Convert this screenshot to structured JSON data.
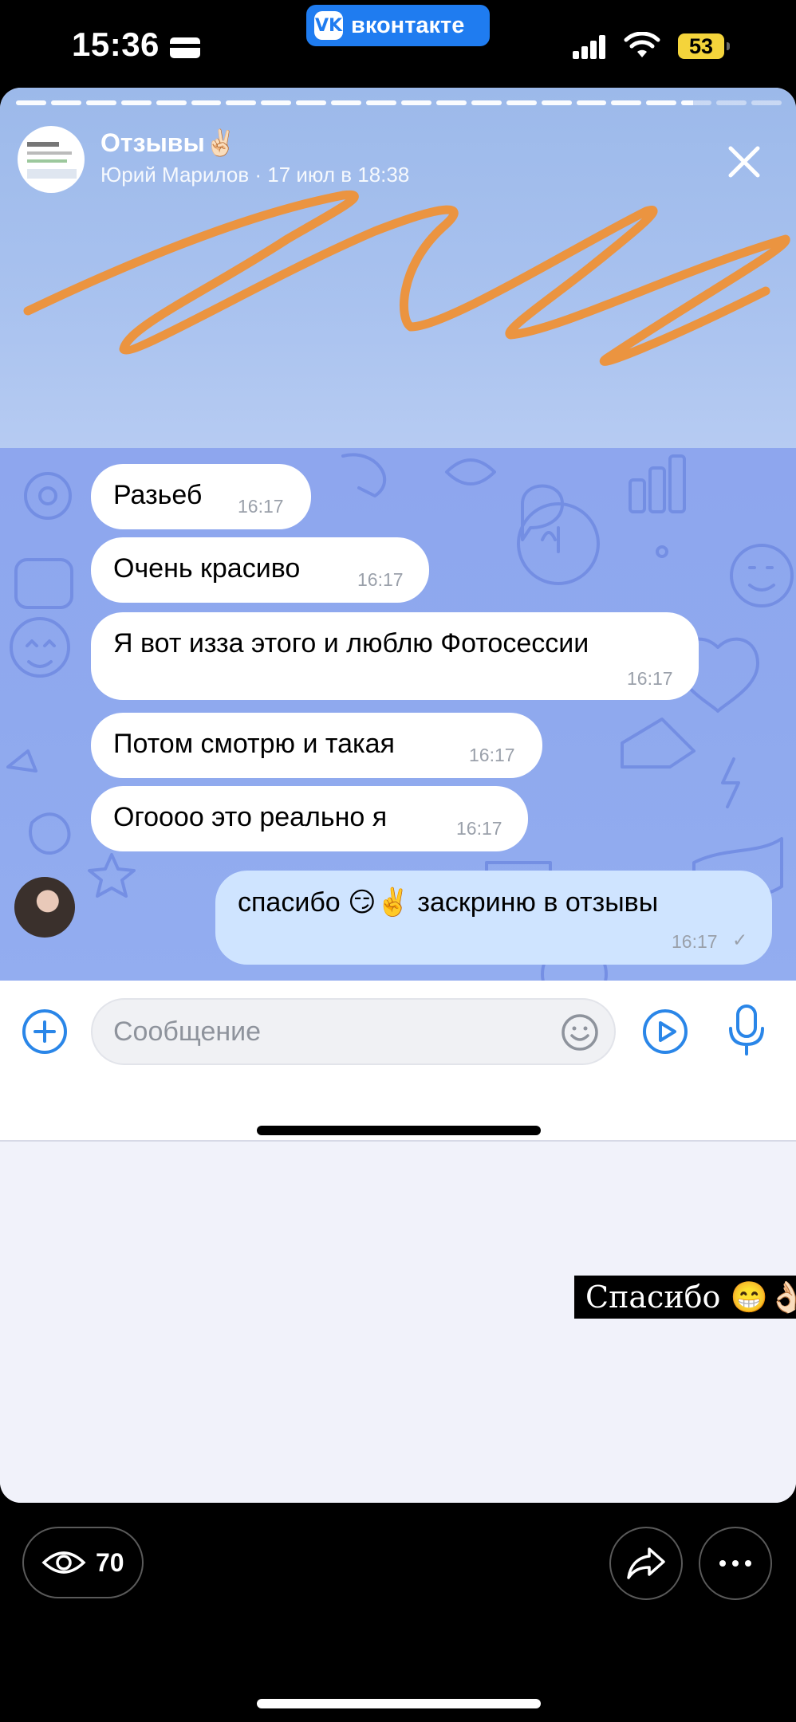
{
  "status_bar": {
    "time": "15:36",
    "app_pill": "вконтакте",
    "app_logo": "VK",
    "battery": "53"
  },
  "story": {
    "title": "Отзывы✌🏻",
    "subtitle": "Юрий Марилов · 17 июл в 18:38",
    "progress_segments_total": 22,
    "progress_segments_done": 19
  },
  "chat": {
    "messages": [
      {
        "text": "Разьеб",
        "time": "16:17",
        "incoming": true
      },
      {
        "text": "Очень красиво",
        "time": "16:17",
        "incoming": true
      },
      {
        "text": "Я вот изза этого и люблю Фотосессии",
        "time": "16:17",
        "incoming": true
      },
      {
        "text": "Потом смотрю и такая",
        "time": "16:17",
        "incoming": true
      },
      {
        "text": "Огоооо это реально я",
        "time": "16:17",
        "incoming": true
      },
      {
        "text": "спасибо 😏✌️ заскриню в отзывы",
        "time": "16:17",
        "status": "✓",
        "incoming": false
      }
    ],
    "input_placeholder": "Сообщение"
  },
  "sticker_caption": "Спасибо 😁👌🏻",
  "bottom_bar": {
    "views": "70"
  },
  "colors": {
    "accent_blue": "#2a86e8",
    "scribble_orange": "#eb9440",
    "chat_bg": "#8ea6ee",
    "outgoing_bubble": "#cfe4ff",
    "battery_yellow": "#f4d43b"
  },
  "icons": [
    "card-icon",
    "vk-logo-icon",
    "signal-icon",
    "wifi-icon",
    "battery-icon",
    "close-icon",
    "plus-icon",
    "emoji-icon",
    "video-icon",
    "mic-icon",
    "eye-icon",
    "share-icon",
    "more-icon"
  ]
}
